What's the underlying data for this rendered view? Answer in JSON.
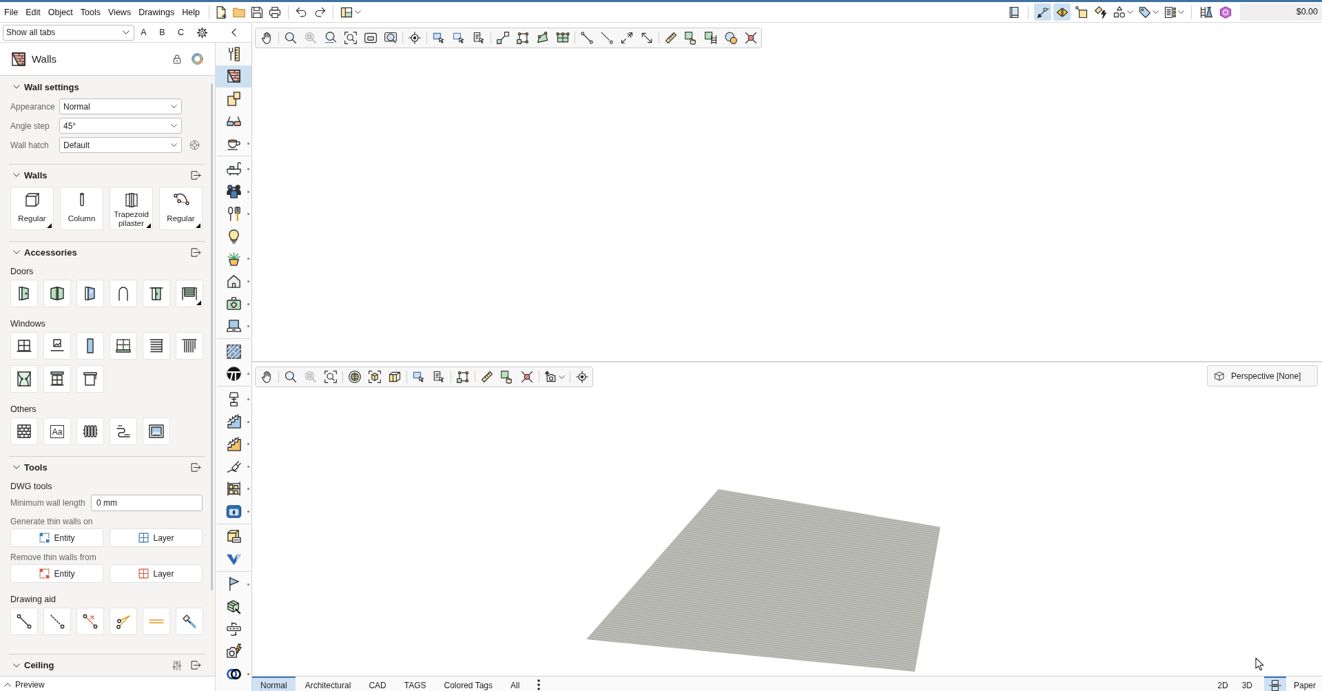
{
  "menu_bar": {
    "menus": [
      "File",
      "Edit",
      "Object",
      "Tools",
      "Views",
      "Drawings",
      "Help"
    ]
  },
  "right_toolbar": [
    {
      "on": false
    },
    {
      "on": true
    },
    {
      "on": true
    },
    {
      "on": false
    },
    {
      "on": false
    },
    {
      "on": false
    },
    {
      "on": false
    },
    {
      "on": false
    },
    {
      "on": false
    },
    {
      "on": false
    }
  ],
  "cost_display": {
    "value": "$0.00"
  },
  "tab_filter": {
    "value": "Show all tabs"
  },
  "tab_sets": [
    {
      "label": "A"
    },
    {
      "label": "B"
    },
    {
      "label": "C"
    }
  ],
  "panel": {
    "title": "Walls",
    "sections": [
      {
        "kind": "settings",
        "title": "Wall settings",
        "expanded": true,
        "fields": [
          {
            "label": "Appearance",
            "value": "Normal"
          },
          {
            "label": "Angle step",
            "value": "45°"
          },
          {
            "label": "Wall hatch",
            "value": "Default"
          }
        ]
      },
      {
        "kind": "tiles",
        "title": "Walls",
        "expanded": true,
        "tools": [
          {
            "label": "Regular",
            "has_options": true
          },
          {
            "label": "Column",
            "has_options": false
          },
          {
            "label": "Trapezoid pilaster",
            "has_options": true
          },
          {
            "label": "Regular",
            "has_options": true
          }
        ]
      },
      {
        "kind": "groups",
        "title": "Accessories",
        "expanded": true,
        "groups": [
          {
            "title": "Doors",
            "items": [
              {
                "has_options": false
              },
              {
                "has_options": false
              },
              {
                "has_options": false
              },
              {
                "has_options": false
              },
              {
                "has_options": false
              },
              {
                "has_options": true
              }
            ]
          },
          {
            "title": "Windows",
            "items": [
              {
                "has_options": false
              },
              {
                "has_options": false
              },
              {
                "has_options": false
              },
              {
                "has_options": false
              },
              {
                "has_options": false
              },
              {
                "has_options": false
              },
              {
                "has_options": false
              },
              {
                "has_options": false
              },
              {
                "has_options": false
              }
            ]
          },
          {
            "title": "Others",
            "items": [
              {
                "has_options": false
              },
              {
                "has_options": false,
                "glyph": "Aa"
              },
              {
                "has_options": false
              },
              {
                "has_options": false
              },
              {
                "has_options": false
              }
            ]
          }
        ]
      },
      {
        "kind": "tools",
        "title": "Tools",
        "expanded": true,
        "rows": [
          {
            "kind": "heading",
            "text": "DWG tools"
          },
          {
            "kind": "input",
            "label": "Minimum wall length",
            "value": "0 mm"
          },
          {
            "kind": "buttons",
            "label": "Generate thin walls on",
            "buttons": [
              {
                "label": "Entity",
                "color": "#3a78b5"
              },
              {
                "label": "Layer",
                "color": "#3a78b5"
              }
            ]
          },
          {
            "kind": "buttons",
            "label": "Remove thin walls from",
            "buttons": [
              {
                "label": "Entity",
                "color": "#d9533c"
              },
              {
                "label": "Layer",
                "color": "#d9533c"
              }
            ]
          },
          {
            "kind": "tiles",
            "title": "Drawing aid",
            "items": [
              {
                "has_options": false
              },
              {
                "has_options": false
              },
              {
                "has_options": false
              },
              {
                "has_options": false
              },
              {
                "has_options": false
              },
              {
                "has_options": false
              }
            ]
          }
        ]
      }
    ],
    "ceiling": {
      "title": "Ceiling",
      "expanded": true
    },
    "preview": {
      "label": "Preview",
      "expanded": false
    }
  },
  "category_strip": [
    {
      "selected": false,
      "flyout": false
    },
    {
      "selected": true,
      "flyout": false
    },
    {
      "selected": false,
      "flyout": false
    },
    {
      "selected": false,
      "flyout": false
    },
    {
      "selected": false,
      "flyout": true
    },
    {
      "selected": false,
      "flyout": true
    },
    {
      "selected": false,
      "flyout": true
    },
    {
      "selected": false,
      "flyout": true
    },
    {
      "selected": false,
      "flyout": false
    },
    {
      "selected": false,
      "flyout": true
    },
    {
      "selected": false,
      "flyout": true
    },
    {
      "selected": false,
      "flyout": true
    },
    {
      "selected": false,
      "flyout": true
    },
    {
      "selected": false,
      "flyout": false
    },
    {
      "selected": false,
      "flyout": true
    },
    {
      "selected": false,
      "flyout": true
    },
    {
      "selected": false,
      "flyout": true
    },
    {
      "selected": false,
      "flyout": true
    },
    {
      "selected": false,
      "flyout": true
    },
    {
      "selected": false,
      "flyout": true
    },
    {
      "selected": false,
      "flyout": true
    },
    {
      "selected": false,
      "flyout": false
    },
    {
      "selected": false,
      "flyout": false
    },
    {
      "selected": false,
      "flyout": true
    },
    {
      "selected": false,
      "flyout": false
    },
    {
      "selected": false,
      "flyout": false
    },
    {
      "selected": false,
      "flyout": false
    },
    {
      "selected": false,
      "flyout": true
    }
  ],
  "camera_button": {
    "label": "Perspective [None]"
  },
  "view_tabs": [
    {
      "label": "Normal",
      "selected": true
    },
    {
      "label": "Architectural",
      "selected": false
    },
    {
      "label": "CAD",
      "selected": false
    },
    {
      "label": "TAGS",
      "selected": false
    },
    {
      "label": "Colored Tags",
      "selected": false
    },
    {
      "label": "All",
      "selected": false
    }
  ],
  "view_modes": [
    {
      "kind": "text",
      "label": "2D",
      "selected": false
    },
    {
      "kind": "text",
      "label": "3D",
      "selected": false
    },
    {
      "kind": "icon",
      "selected": true
    },
    {
      "kind": "text",
      "label": "Paper",
      "selected": false
    }
  ]
}
